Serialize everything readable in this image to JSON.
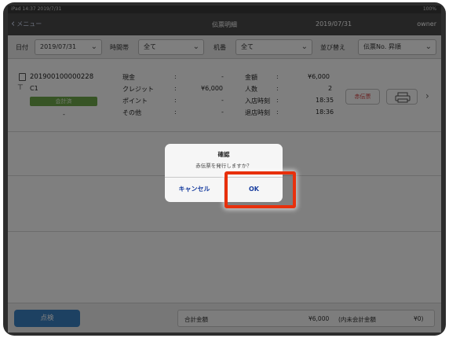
{
  "statusbar": {
    "left": "iPad  14:37  2019/7/31",
    "right": "100%"
  },
  "navbar": {
    "back_label": "メニュー",
    "title": "伝票明細",
    "date": "2019/07/31",
    "user": "owner"
  },
  "filters": {
    "date_label": "日付",
    "date_value": "2019/07/31",
    "time_label": "時間帯",
    "time_value": "全て",
    "seat_label": "机番",
    "seat_value": "全て",
    "sort_label": "並び替え",
    "sort_value": "伝票No. 昇順"
  },
  "record": {
    "slip_no": "201900100000228",
    "table": "C1",
    "status": "会計済",
    "dash": "-",
    "pay_rows": [
      {
        "label": "現金",
        "colon": ":",
        "value": "-"
      },
      {
        "label": "クレジット",
        "colon": ":",
        "value": "¥6,000"
      },
      {
        "label": "ポイント",
        "colon": ":",
        "value": "-"
      },
      {
        "label": "その他",
        "colon": ":",
        "value": "-"
      }
    ],
    "info_rows": [
      {
        "label": "金額",
        "colon": ":",
        "value": "¥6,000"
      },
      {
        "label": "人数",
        "colon": ":",
        "value": "2"
      },
      {
        "label": "入店時刻",
        "colon": ":",
        "value": "18:35"
      },
      {
        "label": "退店時刻",
        "colon": ":",
        "value": "18:36"
      }
    ],
    "cancel_slip_label": "赤伝票"
  },
  "bottom": {
    "check_button": "点検",
    "total_label": "合計金額",
    "total_value": "¥6,000",
    "tax_label": "(内未会計金額",
    "tax_value": "¥0)"
  },
  "dialog": {
    "title": "確認",
    "message": "赤伝票を発行しますか？",
    "cancel_button": "キャンセル",
    "ok_button": "OK"
  },
  "colors": {
    "highlight": "#e8300c",
    "status_paid": "#6fa84a",
    "primary_button": "#3b82c4",
    "cancel_slip_text": "#d23a3a",
    "dialog_button_text": "#1a3fa0"
  },
  "icons": [
    "back-chevron-icon",
    "receipt-icon",
    "table-icon",
    "printer-icon",
    "chevron-right-icon",
    "dropdown-arrow-icon"
  ]
}
